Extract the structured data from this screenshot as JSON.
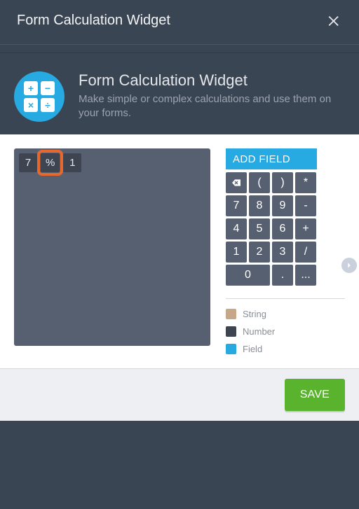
{
  "header": {
    "title": "Form Calculation Widget"
  },
  "widget": {
    "title": "Form Calculation Widget",
    "description": "Make simple or complex calculations and use them on your forms.",
    "badge": {
      "tl": "+",
      "tr": "−",
      "bl": "×",
      "br": "÷"
    }
  },
  "formula": {
    "tokens": [
      {
        "label": "7",
        "kind": "number",
        "highlight": false
      },
      {
        "label": "%",
        "kind": "number",
        "highlight": true
      },
      {
        "label": "1",
        "kind": "number",
        "highlight": false
      }
    ]
  },
  "sidebar": {
    "add_field_label": "ADD FIELD",
    "keypad": [
      [
        "__back__",
        "(",
        ")",
        "*"
      ],
      [
        "7",
        "8",
        "9",
        "-"
      ],
      [
        "4",
        "5",
        "6",
        "+"
      ],
      [
        "1",
        "2",
        "3",
        "/"
      ],
      [
        "__wide0__",
        ".",
        "..."
      ]
    ],
    "legend": [
      {
        "label": "String",
        "color": "#c6a787"
      },
      {
        "label": "Number",
        "color": "#3e4551"
      },
      {
        "label": "Field",
        "color": "#27a9e1"
      }
    ]
  },
  "footer": {
    "save_label": "SAVE"
  }
}
